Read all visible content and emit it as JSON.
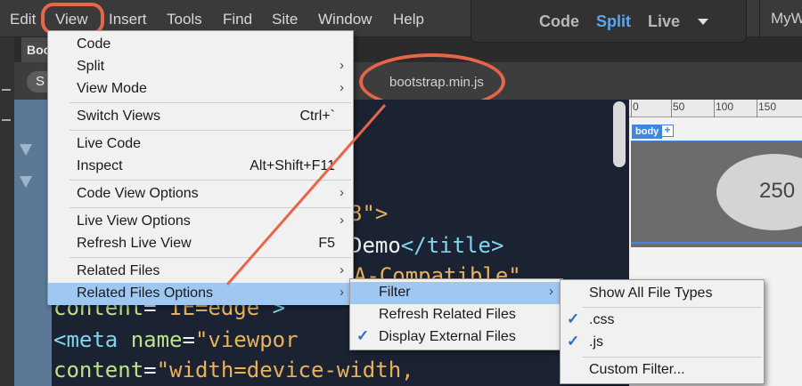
{
  "menubar": {
    "items": [
      "Edit",
      "View",
      "Insert",
      "Tools",
      "Find",
      "Site",
      "Window",
      "Help"
    ],
    "modes": [
      "Code",
      "Split",
      "Live"
    ],
    "active_mode": "Split",
    "site_name": "MyW"
  },
  "document": {
    "tab_label": "Boo",
    "source_pill": "S",
    "related_file": "bootstrap.min.js",
    "code_lines": [
      {
        "parts": [
          {
            "t": "8\">",
            "c": "str"
          }
        ]
      },
      {
        "parts": [
          {
            "t": "Demo",
            "c": "txt"
          },
          {
            "t": "</title>",
            "c": "tag"
          }
        ]
      },
      {
        "parts": [
          {
            "t": "-UA-Compatible\"",
            "c": "str"
          }
        ]
      },
      {
        "parts": [
          {
            "t": "content",
            "c": "attr"
          },
          {
            "t": "=",
            "c": "txt"
          },
          {
            "t": "\"IE=edge\"",
            "c": "str"
          },
          {
            "t": ">",
            "c": "tag"
          }
        ]
      },
      {
        "parts": [
          {
            "t": "<meta ",
            "c": "tag"
          },
          {
            "t": "name",
            "c": "attr"
          },
          {
            "t": "=",
            "c": "txt"
          },
          {
            "t": "\"viewpor",
            "c": "str"
          }
        ]
      },
      {
        "parts": [
          {
            "t": "content",
            "c": "attr"
          },
          {
            "t": "=",
            "c": "txt"
          },
          {
            "t": "\"width=device-width,",
            "c": "str"
          }
        ]
      }
    ]
  },
  "live_view": {
    "ruler_labels": [
      "0",
      "50",
      "100",
      "150"
    ],
    "body_tag": "body",
    "body_plus": "+",
    "placeholder_text": "250"
  },
  "view_menu": [
    {
      "label": "Code",
      "shortcut": "",
      "submenu": false
    },
    {
      "label": "Split",
      "shortcut": "",
      "submenu": true
    },
    {
      "label": "View Mode",
      "shortcut": "",
      "submenu": true
    },
    {
      "label": "Switch Views",
      "shortcut": "Ctrl+`",
      "submenu": false
    },
    {
      "label": "Live Code",
      "shortcut": "",
      "submenu": false
    },
    {
      "label": "Inspect",
      "shortcut": "Alt+Shift+F11",
      "submenu": false
    },
    {
      "label": "Code View Options",
      "shortcut": "",
      "submenu": true
    },
    {
      "label": "Live View Options",
      "shortcut": "",
      "submenu": true
    },
    {
      "label": "Refresh Live View",
      "shortcut": "F5",
      "submenu": false
    },
    {
      "label": "Related Files",
      "shortcut": "",
      "submenu": true
    },
    {
      "label": "Related Files Options",
      "shortcut": "",
      "submenu": true,
      "selected": true
    }
  ],
  "related_files_options_menu": [
    {
      "label": "Filter",
      "submenu": true,
      "selected": true,
      "checked": false
    },
    {
      "label": "Refresh Related Files",
      "submenu": false,
      "checked": false
    },
    {
      "label": "Display External Files",
      "submenu": false,
      "checked": true
    }
  ],
  "filter_menu": [
    {
      "label": "Show All File Types",
      "checked": false
    },
    {
      "label": ".css",
      "checked": true
    },
    {
      "label": ".js",
      "checked": true
    },
    {
      "label": "Custom Filter...",
      "checked": false
    }
  ],
  "icons": {
    "submenu_arrow": "chevron-right-icon",
    "check": "checkmark-icon",
    "mode_dropdown": "caret-down-icon"
  },
  "colors": {
    "highlight_annotation": "#e8654a",
    "menu_selection": "#9ec8f2",
    "active_mode": "#5aa6f0",
    "check": "#2e6fc4"
  }
}
